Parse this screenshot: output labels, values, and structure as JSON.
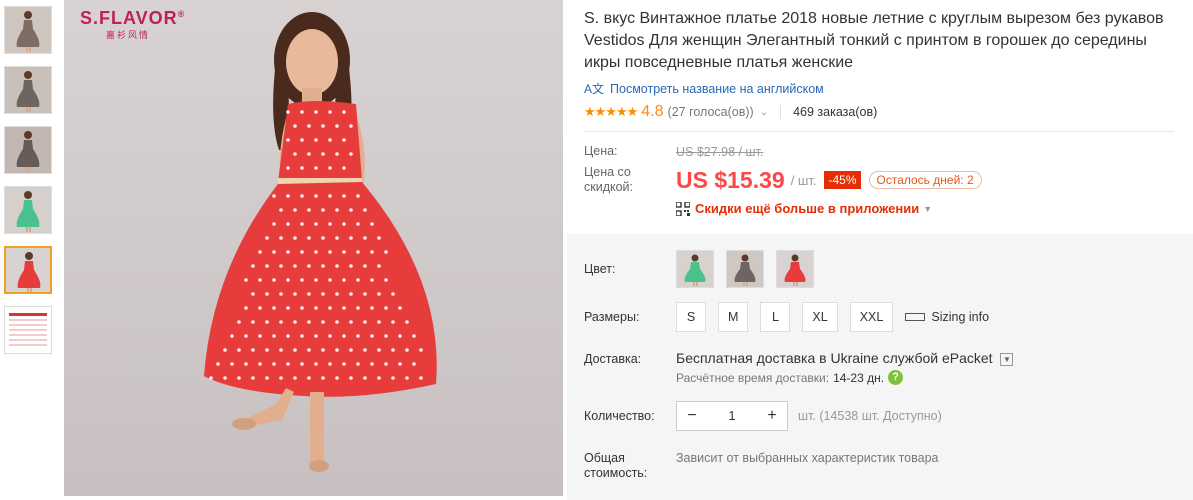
{
  "brand": {
    "name": "S.FLAVOR",
    "reg": "®",
    "sub": "嘉衫风情"
  },
  "thumbnails": [
    {
      "name": "thumb-1",
      "colors": [
        "#7d6c63",
        "#cfc6bf"
      ]
    },
    {
      "name": "thumb-2",
      "colors": [
        "#6f6560",
        "#c9c0ba"
      ]
    },
    {
      "name": "thumb-3",
      "colors": [
        "#665c57",
        "#c2b8b1"
      ]
    },
    {
      "name": "thumb-4",
      "colors": [
        "#4bc28e",
        "#d5d0cc"
      ]
    },
    {
      "name": "thumb-5",
      "colors": [
        "#e63c3c",
        "#d8d2d2"
      ]
    },
    {
      "name": "thumb-6",
      "colors": [
        "#f2f2f2",
        "#ffffff"
      ]
    }
  ],
  "product": {
    "title": "S. вкус Винтажное платье 2018 новые летние с круглым вырезом без рукавов Vestidos Для женщин Элегантный тонкий с принтом в горошек до середины икры повседневные платья женские",
    "translate_link": "Посмотреть название на английском",
    "translate_icon": "translate-icon",
    "stars": "★★★★★",
    "rating": "4.8",
    "votes": "(27 голоса(ов))",
    "orders": "469 заказа(ов)"
  },
  "price": {
    "old_label": "Цена:",
    "old_value": "US $27.98 / шт.",
    "new_label": "Цена со скидкой:",
    "new_value": "US $15.39",
    "per_unit": "/ шт.",
    "discount": "-45%",
    "days_left": "Осталось дней: 2",
    "app_promo": "Скидки ещё больше в приложении"
  },
  "options": {
    "color_label": "Цвет:",
    "color_swatches": [
      {
        "dress": "#4bc28e",
        "bg": "#d7d2ce"
      },
      {
        "dress": "#6f6560",
        "bg": "#cfc8c2"
      },
      {
        "dress": "#e63c3c",
        "bg": "#d8d2d2"
      }
    ],
    "size_label": "Размеры:",
    "sizes": [
      "S",
      "M",
      "L",
      "XL",
      "XXL"
    ],
    "sizing_info": "Sizing info",
    "shipping_label": "Доставка:",
    "shipping_main": "Бесплатная доставка в Ukraine службой ePacket",
    "shipping_time_label": "Расчётное время доставки:",
    "shipping_time_value": "14-23 дн.",
    "qty_label": "Количество:",
    "qty_value": "1",
    "qty_minus": "−",
    "qty_plus": "+",
    "qty_note": "шт. (14538 шт. Доступно)",
    "total_label": "Общая стоимость:",
    "total_value": "Зависит от выбранных характеристик товара"
  },
  "colors": {
    "accent": "#ff4747",
    "link": "#2a66b8",
    "star": "#ff8c00",
    "dress_red": "#e63c3c"
  }
}
